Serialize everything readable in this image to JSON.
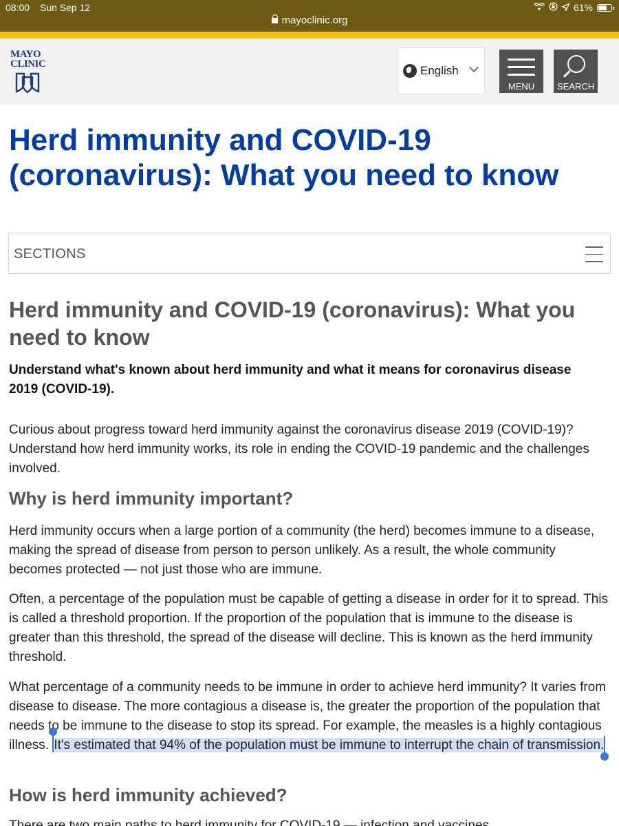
{
  "status_bar": {
    "time": "08:00",
    "date": "Sun Sep 12",
    "battery": "61%",
    "url": "mayoclinic.org"
  },
  "header": {
    "logo_line1": "MAYO",
    "logo_line2": "CLINIC",
    "language": "English",
    "menu_label": "MENU",
    "search_label": "SEARCH"
  },
  "page": {
    "title": "Herd immunity and COVID-19 (coronavirus): What you need to know",
    "sections_label": "SECTIONS"
  },
  "article": {
    "title": "Herd immunity and COVID-19 (coronavirus): What you need to know",
    "intro": "Understand what's known about herd immunity and what it means for coronavirus disease 2019 (COVID-19).",
    "p1": "Curious about progress toward herd immunity against the coronavirus disease 2019 (COVID-19)? Understand how herd immunity works, its role in ending the COVID-19 pandemic and the challenges involved.",
    "h2_important": "Why is herd immunity important?",
    "p2": "Herd immunity occurs when a large portion of a community (the herd) becomes immune to a disease, making the spread of disease from person to person unlikely. As a result, the whole community becomes protected — not just those who are immune.",
    "p3": "Often, a percentage of the population must be capable of getting a disease in order for it to spread. This is called a threshold proportion. If the proportion of the population that is immune to the disease is greater than this threshold, the spread of the disease will decline. This is known as the herd immunity threshold.",
    "p4_before": "What percentage of a community needs to be immune in order to achieve herd immunity? It varies from disease to disease. The more contagious a disease is, the greater the proportion of the population that needs to be immune to the disease to stop its spread. For example, the measles is a highly contagious illness. ",
    "p4_highlight": "It's estimated that 94% of the population must be immune to interrupt the chain of transmission.",
    "h2_achieved": "How is herd immunity achieved?",
    "p5": "There are two main paths to herd immunity for COVID-19 — infection and vaccines."
  },
  "colors": {
    "status_bar": "#6e5a14",
    "gold_accent": "#f2c010",
    "title_blue": "#003da5",
    "header_gray": "#f2f2f2",
    "button_gray": "#505050",
    "selection_highlight": "#cfe0f7",
    "selection_handle": "#3478d8"
  },
  "icons": [
    "lock-icon",
    "wifi-icon",
    "location-icon",
    "battery-icon",
    "globe-icon",
    "chevron-down-icon",
    "hamburger-icon",
    "search-icon"
  ]
}
